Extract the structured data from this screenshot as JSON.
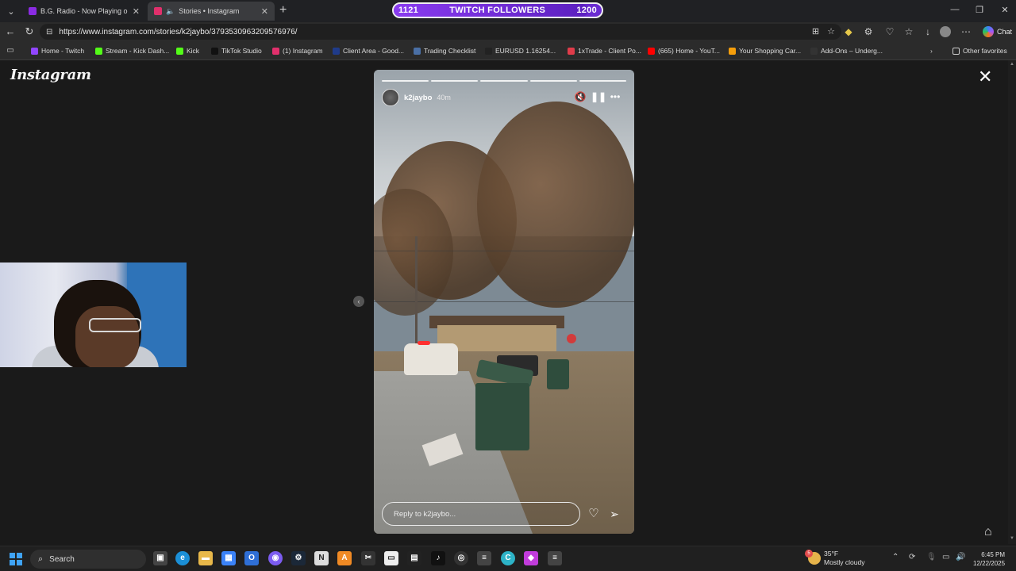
{
  "browser": {
    "tabs": [
      {
        "title": "B.G. Radio - Now Playing on I",
        "active": false
      },
      {
        "title": "Stories • Instagram",
        "active": true
      }
    ],
    "twitch_goal": {
      "current": "1121",
      "label": "TWITCH FOLLOWERS",
      "target": "1200",
      "progress": 0.934
    },
    "url": "https://www.instagram.com/stories/k2jaybo/3793530963209576976/",
    "chat_label": "Chat",
    "bookmarks": [
      {
        "label": "Home - Twitch",
        "color": "#9146ff"
      },
      {
        "label": "Stream - Kick Dash...",
        "color": "#53fc18"
      },
      {
        "label": "Kick",
        "color": "#53fc18"
      },
      {
        "label": "TikTok Studio",
        "color": "#111111"
      },
      {
        "label": "(1) Instagram",
        "color": "#e1306c"
      },
      {
        "label": "Client Area - Good...",
        "color": "#1f3b8a"
      },
      {
        "label": "Trading Checklist",
        "color": "#4a6fa5"
      },
      {
        "label": "EURUSD 1.16254...",
        "color": "#222222"
      },
      {
        "label": "1xTrade - Client Po...",
        "color": "#e03c4a"
      },
      {
        "label": "(665) Home - YouT...",
        "color": "#ff0000"
      },
      {
        "label": "Your Shopping Car...",
        "color": "#f59e0b"
      },
      {
        "label": "Add-Ons – Underg...",
        "color": "#333333"
      }
    ],
    "other_favorites": "Other favorites"
  },
  "instagram": {
    "logo": "Instagram",
    "story": {
      "username": "k2jaybo",
      "time": "40m",
      "segments": 5,
      "reply_placeholder": "Reply to k2jaybo..."
    }
  },
  "taskbar": {
    "search_label": "Search",
    "weather": {
      "temp": "35°F",
      "condition": "Mostly cloudy",
      "badge": "5"
    },
    "time": "6:45 PM",
    "date": "12/22/2025"
  }
}
